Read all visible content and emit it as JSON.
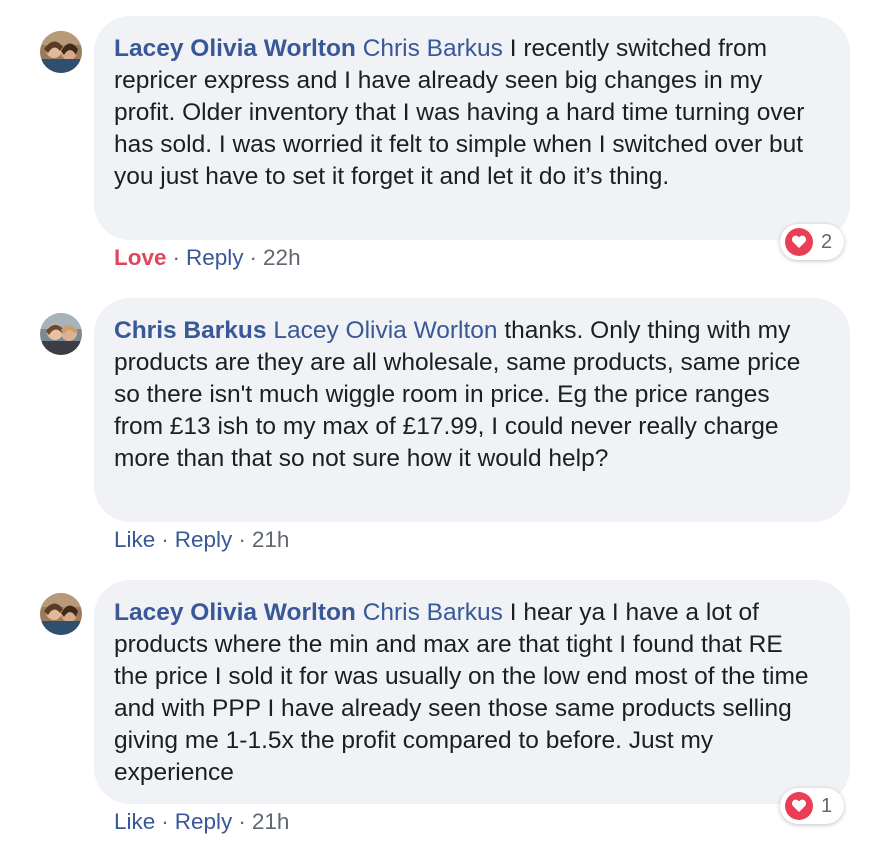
{
  "comments": [
    {
      "author": "Lacey Olivia Worlton",
      "mention": "Chris Barkus",
      "text": "I recently switched from repricer express and I have already seen big changes in my profit. Older inventory that I was having a hard time turning over has sold. I was worried it felt to simple when I switched over but you just have to set it forget it and let it do it’s thing.",
      "like_label": "Love",
      "liked": true,
      "reply_label": "Reply",
      "time": "22h",
      "reaction_count": "2",
      "avatar": {
        "bg": "#8b6f58",
        "icon": "user-avatar-icon"
      }
    },
    {
      "author": "Chris Barkus",
      "mention": "Lacey Olivia Worlton",
      "text": "thanks. Only thing with my products are they are all wholesale, same products, same price so there isn't much wiggle room in price. Eg the price ranges from £13 ish to my max of £17.99, I could never really charge more than that so not sure how it would help?",
      "like_label": "Like",
      "liked": false,
      "reply_label": "Reply",
      "time": "21h",
      "avatar": {
        "bg": "#6f7d86",
        "icon": "user-avatar-icon"
      }
    },
    {
      "author": "Lacey Olivia Worlton",
      "mention": "Chris Barkus",
      "text": "I hear ya I have a lot of products where the min and max are that tight I found that RE the price I sold it for was usually on the low end most of the time and with PPP I have already seen those same products selling giving me 1-1.5x the profit compared to before. Just my experience",
      "like_label": "Like",
      "liked": false,
      "reply_label": "Reply",
      "time": "21h",
      "reaction_count": "1",
      "avatar": {
        "bg": "#8b6f58",
        "icon": "user-avatar-icon"
      }
    }
  ],
  "colors": {
    "link": "#385898",
    "love": "#e0475c",
    "bubble": "#f0f2f5",
    "meta": "#616770",
    "heart": "#e93e56"
  }
}
